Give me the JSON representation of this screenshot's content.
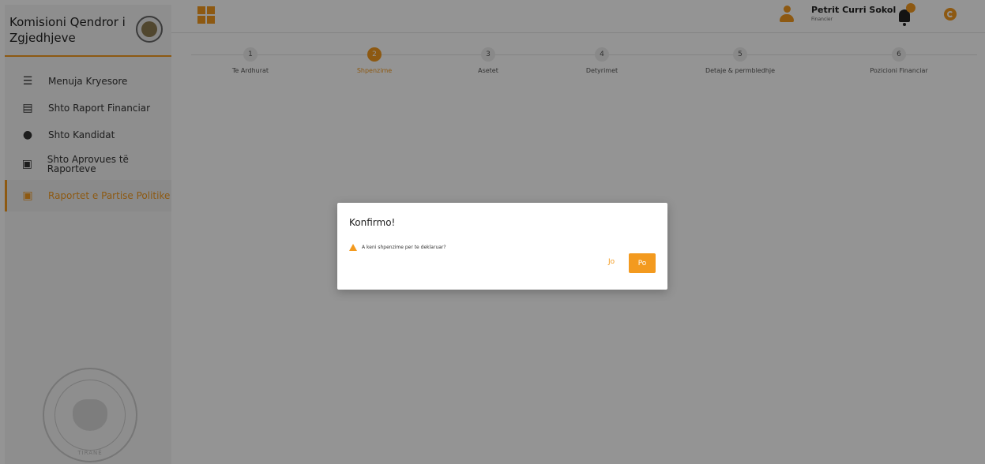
{
  "sidebar": {
    "brand_title": "Komisioni Qendror i Zgjedhjeve",
    "items": [
      {
        "label": "Menuja Kryesore",
        "icon": "list-icon"
      },
      {
        "label": "Shto Raport Financiar",
        "icon": "report-icon"
      },
      {
        "label": "Shto Kandidat",
        "icon": "add-user-icon"
      },
      {
        "label": "Shto Aprovues të Raporteve",
        "icon": "approver-icon"
      },
      {
        "label": "Raportet e Partise Politike",
        "icon": "party-report-icon",
        "active": true
      }
    ],
    "seal_text": "TIRANË"
  },
  "header": {
    "user_name": "Petrit Curri Sokol",
    "user_role": "Financier"
  },
  "stepper": {
    "steps": [
      {
        "number": "1",
        "label": "Te Ardhurat"
      },
      {
        "number": "2",
        "label": "Shpenzime",
        "active": true
      },
      {
        "number": "3",
        "label": "Asetet"
      },
      {
        "number": "4",
        "label": "Detyrimet"
      },
      {
        "number": "5",
        "label": "Detaje & permbledhje"
      },
      {
        "number": "6",
        "label": "Pozicioni Financiar"
      }
    ]
  },
  "modal": {
    "title": "Konfirmo!",
    "message": "A keni shpenzime per te deklaruar?",
    "no_label": "Jo",
    "yes_label": "Po"
  },
  "colors": {
    "accent": "#f39a1f",
    "overlay": "rgba(0,0,0,0.42)"
  }
}
